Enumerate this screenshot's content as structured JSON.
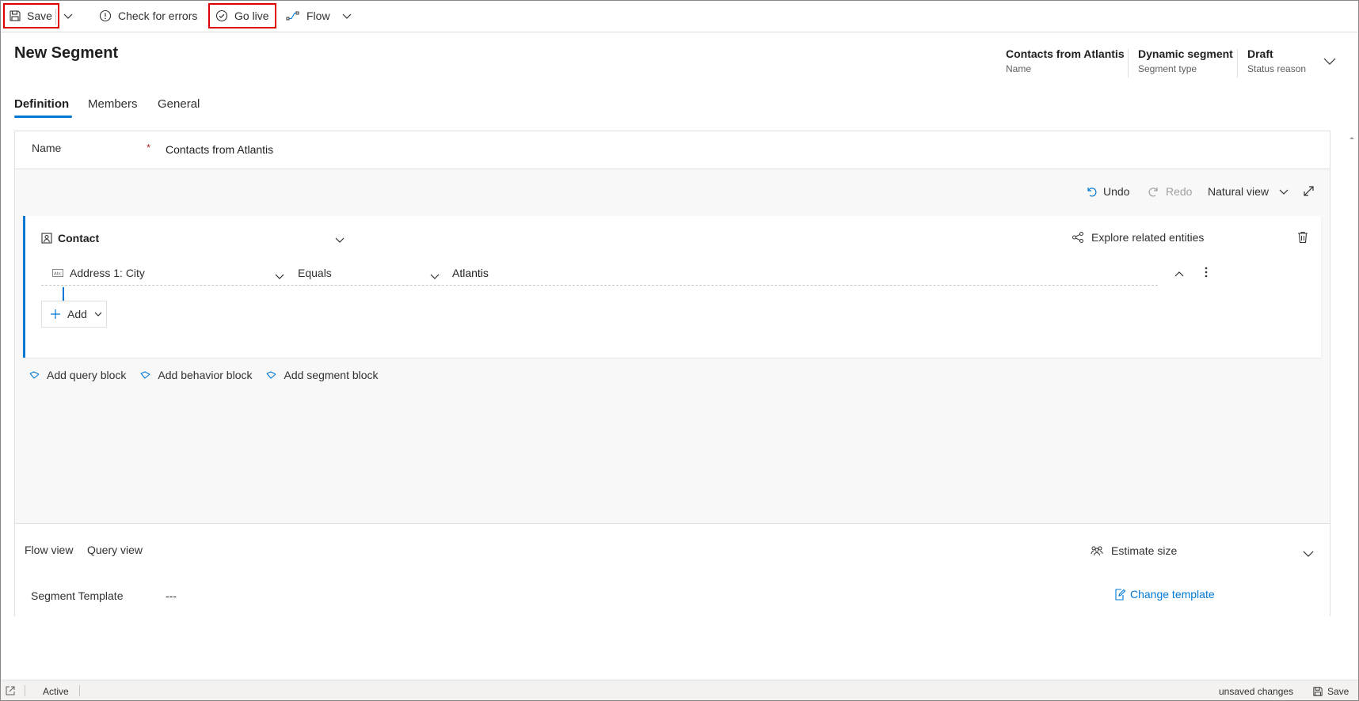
{
  "toolbar": {
    "save_label": "Save",
    "check_errors_label": "Check for errors",
    "go_live_label": "Go live",
    "flow_label": "Flow"
  },
  "header": {
    "title": "New Segment",
    "fields": [
      {
        "value": "Contacts from Atlantis",
        "label": "Name"
      },
      {
        "value": "Dynamic segment",
        "label": "Segment type"
      },
      {
        "value": "Draft",
        "label": "Status reason"
      }
    ]
  },
  "tabs": [
    "Definition",
    "Members",
    "General"
  ],
  "active_tab": "Definition",
  "form": {
    "name_label": "Name",
    "required_mark": "*",
    "name_value": "Contacts from Atlantis"
  },
  "designer": {
    "undo_label": "Undo",
    "redo_label": "Redo",
    "view_label": "Natural view",
    "block": {
      "entity": "Contact",
      "explore_label": "Explore related entities",
      "condition": {
        "field": "Address 1: City",
        "operator": "Equals",
        "value": "Atlantis"
      },
      "add_label": "Add"
    },
    "add_links": [
      "Add query block",
      "Add behavior block",
      "Add segment block"
    ]
  },
  "bottom": {
    "view_tabs": [
      "Flow view",
      "Query view"
    ],
    "estimate_label": "Estimate size",
    "template_label": "Segment Template",
    "template_value": "---",
    "change_template_label": "Change template"
  },
  "statusbar": {
    "state": "Active",
    "unsaved": "unsaved changes",
    "save_label": "Save"
  },
  "colors": {
    "accent": "#0078d4",
    "highlight": "#e00000",
    "required": "#a4262c"
  }
}
